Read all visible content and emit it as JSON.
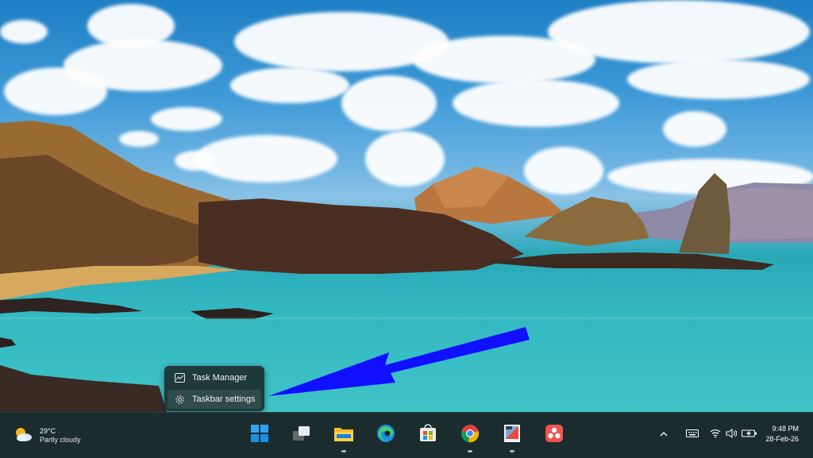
{
  "context_menu": {
    "items": [
      {
        "label": "Task Manager"
      },
      {
        "label": "Taskbar settings"
      }
    ]
  },
  "taskbar": {
    "weather": {
      "temperature": "29°C",
      "condition": "Partly cloudy"
    },
    "apps": [
      {
        "name": "Start",
        "icon": "windows-logo-icon"
      },
      {
        "name": "Task View",
        "icon": "task-view-icon"
      },
      {
        "name": "File Explorer",
        "icon": "folder-icon"
      },
      {
        "name": "Microsoft Edge",
        "icon": "edge-icon"
      },
      {
        "name": "Microsoft Store",
        "icon": "store-icon"
      },
      {
        "name": "Google Chrome",
        "icon": "chrome-icon"
      },
      {
        "name": "Paint",
        "icon": "paint-icon"
      },
      {
        "name": "Asana",
        "icon": "asana-icon"
      }
    ],
    "clock": {
      "time": "9:48 PM",
      "date": "28-Feb-26"
    }
  },
  "colors": {
    "taskbar_bg": "#1b2c2e",
    "menu_bg": "#1f3a3b",
    "arrow": "#1010ff"
  }
}
